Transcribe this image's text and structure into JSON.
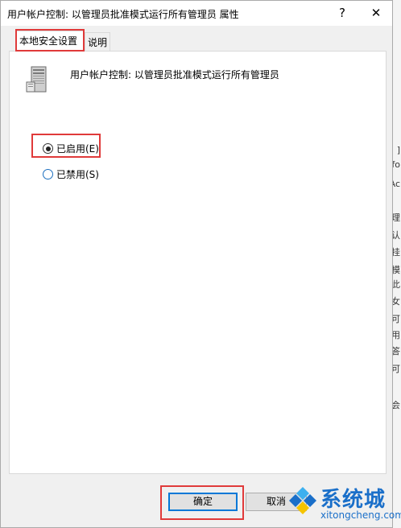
{
  "dialog": {
    "title": "用户帐户控制: 以管理员批准模式运行所有管理员 属性",
    "help_glyph": "?",
    "close_glyph": "✕"
  },
  "tabs": [
    {
      "label": "本地安全设置",
      "active": true
    },
    {
      "label": "说明",
      "active": false
    }
  ],
  "policy": {
    "title": "用户帐户控制: 以管理员批准模式运行所有管理员",
    "icon": "server-computer-icon"
  },
  "options": [
    {
      "label": "已启用(E)",
      "checked": true
    },
    {
      "label": "已禁用(S)",
      "checked": false
    }
  ],
  "buttons": {
    "ok": "确定",
    "cancel": "取消"
  },
  "background": {
    "right_fragments": [
      "]",
      "fo",
      "Ac",
      "理",
      "认",
      "挂",
      "模",
      "此",
      "女",
      "可",
      "用",
      "答",
      "可",
      "会"
    ]
  },
  "watermark": {
    "brand_cn": "系统城",
    "brand_en": "xitongcheng.com"
  },
  "colors": {
    "accent": "#0078d7",
    "highlight_box": "#e03a3a",
    "watermark": "#1a6fc9"
  }
}
